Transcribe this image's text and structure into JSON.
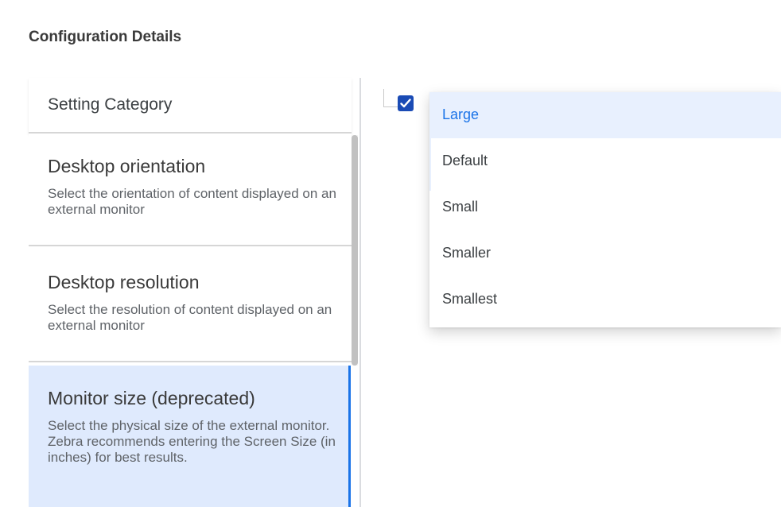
{
  "header": {
    "title": "Configuration Details"
  },
  "settings": {
    "category_header": "Setting Category",
    "items": [
      {
        "title": "Desktop orientation",
        "description": "Select the orientation of content displayed on an external monitor"
      },
      {
        "title": "Desktop resolution",
        "description": "Select the resolution of content displayed on an external monitor"
      },
      {
        "title": "Monitor size (deprecated)",
        "description": "Select the physical size of the external monitor. Zebra recommends entering the Screen Size (in inches) for best results."
      }
    ]
  },
  "option_list": {
    "checkbox_checked": true,
    "options": [
      "Large",
      "Default",
      "Small",
      "Smaller",
      "Smallest"
    ],
    "highlighted": "Large"
  },
  "colors": {
    "accent": "#1a73e8",
    "selected_bg": "#dfeafd",
    "checkbox": "#1a4bb5"
  }
}
